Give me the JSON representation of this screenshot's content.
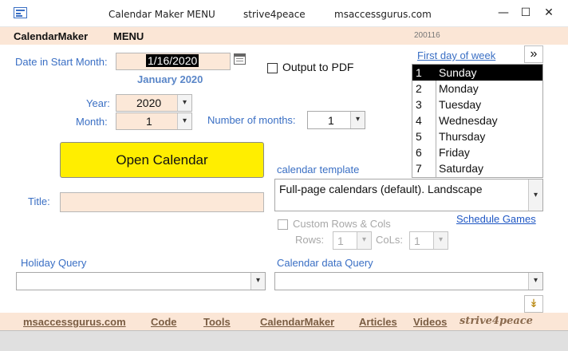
{
  "window": {
    "title_left": "Calendar Maker MENU",
    "title_mid": "strive4peace",
    "title_right": "msaccessgurus.com",
    "minimize_glyph": "—",
    "maximize_glyph": "☐",
    "close_glyph": "✕"
  },
  "header": {
    "app_name": "CalendarMaker",
    "menu_label": "MENU",
    "version": "200116"
  },
  "form": {
    "date_label": "Date in Start Month:",
    "date_value": "1/16/2020",
    "month_display": "January 2020",
    "year_label": "Year:",
    "year_value": "2020",
    "month_label": "Month:",
    "month_value": "1",
    "num_months_label": "Number of months:",
    "num_months_value": "1",
    "output_pdf_label": "Output to PDF",
    "open_calendar_label": "Open Calendar",
    "title_label": "Title:",
    "title_value": "",
    "template_label": "calendar template",
    "template_value": "Full-page calendars (default). Landscape",
    "custom_label": "Custom Rows & Cols",
    "rows_label": "Rows:",
    "rows_value": "1",
    "cols_label": "CoLs:",
    "cols_value": "1",
    "schedule_games_label": "Schedule Games",
    "holiday_query_label": "Holiday Query",
    "holiday_query_value": "",
    "calendar_data_label": "Calendar data Query",
    "calendar_data_value": "",
    "first_day_label": "First day of week",
    "nav_glyph": "»",
    "expand_glyph": "↡"
  },
  "days_of_week": [
    {
      "num": "1",
      "day": "Sunday"
    },
    {
      "num": "2",
      "day": "Monday"
    },
    {
      "num": "3",
      "day": "Tuesday"
    },
    {
      "num": "4",
      "day": "Wednesday"
    },
    {
      "num": "5",
      "day": "Thursday"
    },
    {
      "num": "6",
      "day": "Friday"
    },
    {
      "num": "7",
      "day": "Saturday"
    }
  ],
  "footer": {
    "links": [
      "msaccessgurus.com",
      "Code",
      "Tools",
      "CalendarMaker",
      "Articles",
      "Videos"
    ],
    "signature": "strive4peace"
  },
  "colors": {
    "accent_blue": "#3a6fc4",
    "header_bg": "#fbe6d6",
    "button_yellow": "#ffee00",
    "field_bg": "#fce8d8"
  }
}
